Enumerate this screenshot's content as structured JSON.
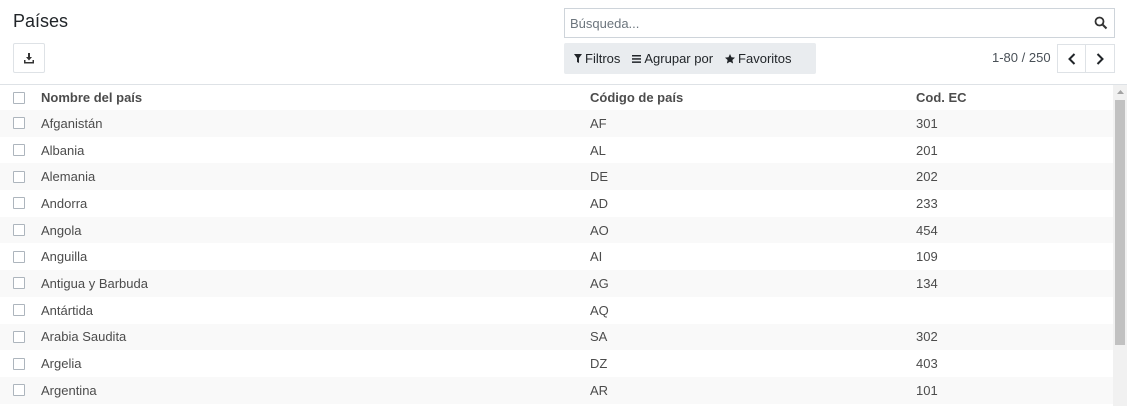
{
  "page_title": "Países",
  "search": {
    "placeholder": "Búsqueda..."
  },
  "filters": {
    "filters_label": "Filtros",
    "group_label": "Agrupar por",
    "favorites_label": "Favoritos"
  },
  "pager": {
    "range": "1-80 / 250"
  },
  "table": {
    "headers": {
      "name": "Nombre del país",
      "code": "Código de país",
      "ec": "Cod. EC"
    },
    "rows": [
      {
        "name": "Afganistán",
        "code": "AF",
        "ec": "301"
      },
      {
        "name": "Albania",
        "code": "AL",
        "ec": "201"
      },
      {
        "name": "Alemania",
        "code": "DE",
        "ec": "202"
      },
      {
        "name": "Andorra",
        "code": "AD",
        "ec": "233"
      },
      {
        "name": "Angola",
        "code": "AO",
        "ec": "454"
      },
      {
        "name": "Anguilla",
        "code": "AI",
        "ec": "109"
      },
      {
        "name": "Antigua y Barbuda",
        "code": "AG",
        "ec": "134"
      },
      {
        "name": "Antártida",
        "code": "AQ",
        "ec": ""
      },
      {
        "name": "Arabia Saudita",
        "code": "SA",
        "ec": "302"
      },
      {
        "name": "Argelia",
        "code": "DZ",
        "ec": "403"
      },
      {
        "name": "Argentina",
        "code": "AR",
        "ec": "101"
      }
    ]
  }
}
